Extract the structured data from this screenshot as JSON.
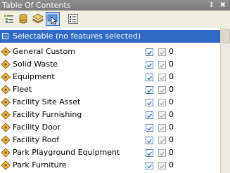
{
  "window": {
    "title": "Table Of Contents",
    "pin_glyph": "↕",
    "close_glyph": "✖"
  },
  "toolbar": {
    "buttons": [
      {
        "id": "list-by-drawing-order",
        "icon": "layers-list-icon"
      },
      {
        "id": "list-by-source",
        "icon": "database-icon"
      },
      {
        "id": "list-by-visibility",
        "icon": "layer-stack-icon"
      },
      {
        "id": "list-by-selection",
        "icon": "selection-icon",
        "active": true
      },
      {
        "id": "options",
        "icon": "options-list-icon"
      }
    ]
  },
  "group": {
    "label": "Selectable (no features selected)",
    "expanded": true
  },
  "layers": [
    {
      "name": "General Custom",
      "count": "0"
    },
    {
      "name": "Solid Waste",
      "count": "0"
    },
    {
      "name": "Equipment",
      "count": "0"
    },
    {
      "name": "Fleet",
      "count": "0"
    },
    {
      "name": "Facility Site Asset",
      "count": "0"
    },
    {
      "name": "Facility Furnishing",
      "count": "0"
    },
    {
      "name": "Facility Door",
      "count": "0"
    },
    {
      "name": "Facility Roof",
      "count": "0"
    },
    {
      "name": "Park Playground Equipment",
      "count": "0"
    },
    {
      "name": "Park Furniture",
      "count": "0"
    }
  ],
  "colors": {
    "header_bg": "#316ac5",
    "titlebar_bg": "#808080",
    "toolbar_bg": "#f1efe2"
  }
}
